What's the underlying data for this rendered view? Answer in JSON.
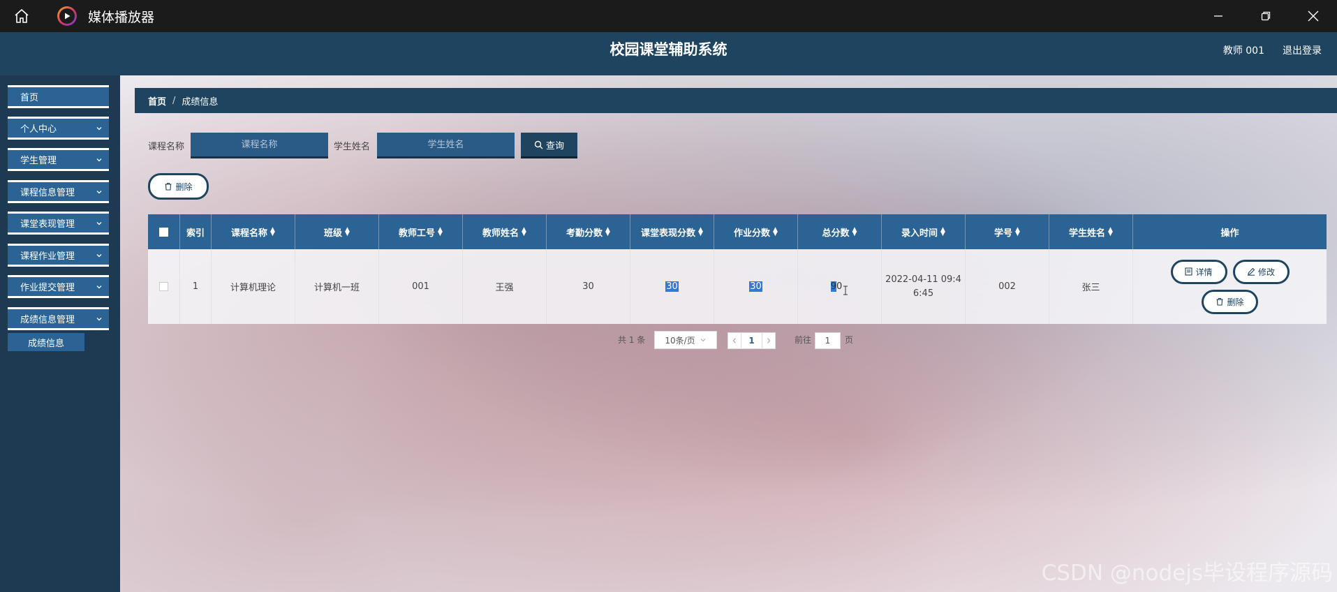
{
  "window": {
    "app_title": "媒体播放器"
  },
  "header": {
    "system_title": "校园课堂辅助系统",
    "user": "教师 001",
    "logout": "退出登录"
  },
  "sidebar": {
    "items": [
      {
        "label": "首页",
        "has_chevron": false
      },
      {
        "label": "个人中心",
        "has_chevron": true
      },
      {
        "label": "学生管理",
        "has_chevron": true
      },
      {
        "label": "课程信息管理",
        "has_chevron": true
      },
      {
        "label": "课堂表现管理",
        "has_chevron": true
      },
      {
        "label": "课程作业管理",
        "has_chevron": true
      },
      {
        "label": "作业提交管理",
        "has_chevron": true
      },
      {
        "label": "成绩信息管理",
        "has_chevron": true
      }
    ],
    "subitem": "成绩信息"
  },
  "breadcrumb": {
    "home": "首页",
    "separator": "/",
    "current": "成绩信息"
  },
  "search": {
    "course_label": "课程名称",
    "course_placeholder": "课程名称",
    "student_label": "学生姓名",
    "student_placeholder": "学生姓名",
    "query_button": "查询"
  },
  "toolbar": {
    "delete_button": "删除"
  },
  "table": {
    "headers": [
      "索引",
      "课程名称",
      "班级",
      "教师工号",
      "教师姓名",
      "考勤分数",
      "课堂表现分数",
      "作业分数",
      "总分数",
      "录入时间",
      "学号",
      "学生姓名",
      "操作"
    ],
    "rows": [
      {
        "index": "1",
        "course": "计算机理论",
        "class": "计算机一班",
        "teacher_id": "001",
        "teacher_name": "王强",
        "attendance": "30",
        "performance": "30",
        "homework": "30",
        "total": "90",
        "time_line1": "2022-04-11 09:4",
        "time_line2": "6:45",
        "student_id": "002",
        "student_name": "张三",
        "actions": {
          "detail": "详情",
          "edit": "修改",
          "delete": "删除"
        }
      }
    ]
  },
  "pagination": {
    "total_text": "共 1 条",
    "page_size": "10条/页",
    "current_page": "1",
    "goto_prefix": "前往",
    "goto_value": "1",
    "goto_suffix": "页"
  },
  "watermark": "CSDN @nodejs毕设程序源码",
  "colors": {
    "header_bg": "#1f4460",
    "table_header_bg": "#2a6394",
    "sidebar_bg": "#1e3a52",
    "selection": "#2f7ad8"
  }
}
